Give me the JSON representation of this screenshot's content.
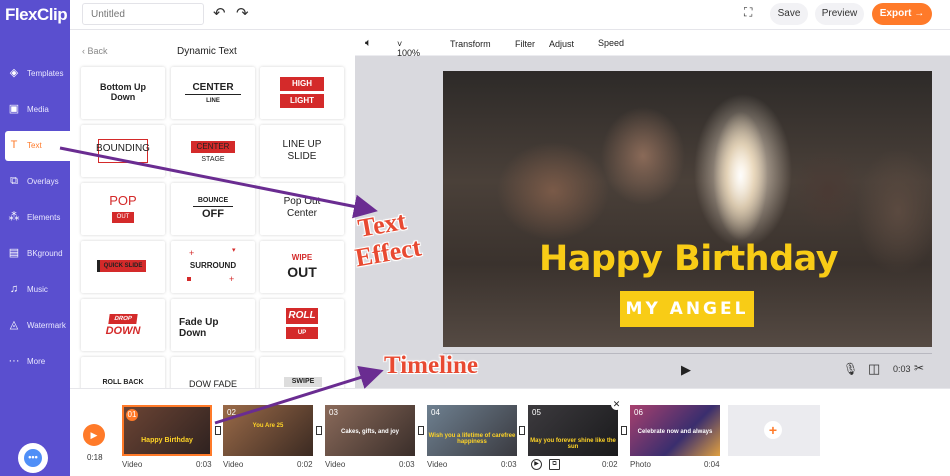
{
  "app": {
    "logo": "FlexClip",
    "project_title_placeholder": "Untitled"
  },
  "header": {
    "save": "Save",
    "preview": "Preview",
    "export": "Export →"
  },
  "sidebar": {
    "items": [
      {
        "label": "Templates",
        "icon": "layers-icon",
        "glyph": "◈"
      },
      {
        "label": "Media",
        "icon": "media-icon",
        "glyph": "▣"
      },
      {
        "label": "Text",
        "icon": "text-icon",
        "glyph": "T"
      },
      {
        "label": "Overlays",
        "icon": "overlays-icon",
        "glyph": "⧉"
      },
      {
        "label": "Elements",
        "icon": "elements-icon",
        "glyph": "⁂"
      },
      {
        "label": "BKground",
        "icon": "background-icon",
        "glyph": "▤"
      },
      {
        "label": "Music",
        "icon": "music-icon",
        "glyph": "♫"
      },
      {
        "label": "Watermark",
        "icon": "watermark-icon",
        "glyph": "◬"
      },
      {
        "label": "More",
        "icon": "more-icon",
        "glyph": "···"
      }
    ],
    "active": "Text"
  },
  "panel": {
    "back": "Back",
    "title": "Dynamic Text",
    "tiles": [
      {
        "l1": "Bottom Up",
        "l2": "Down"
      },
      {
        "l1": "CENTER",
        "l2": "LINE"
      },
      {
        "l1": "HIGH",
        "l2": "LIGHT"
      },
      {
        "l1": "BOUNDING",
        "l2": ""
      },
      {
        "l1": "CENTER",
        "l2": "STAGE"
      },
      {
        "l1": "LINE UP",
        "l2": "SLIDE"
      },
      {
        "l1": "POP",
        "l2": "OUT"
      },
      {
        "l1": "BOUNCE",
        "l2": "OFF"
      },
      {
        "l1": "Pop Out",
        "l2": "Center"
      },
      {
        "l1": "QUICK SLIDE",
        "l2": ""
      },
      {
        "l1": "SURROUND",
        "l2": ""
      },
      {
        "l1": "WIPE",
        "l2": "OUT"
      },
      {
        "l1": "DROP",
        "l2": "DOWN"
      },
      {
        "l1": "Fade Up",
        "l2": "Down"
      },
      {
        "l1": "ROLL",
        "l2": "UP"
      },
      {
        "l1": "ROLL BACK",
        "l2": ""
      },
      {
        "l1": "DOW FADE",
        "l2": ""
      },
      {
        "l1": "SWIPE",
        "l2": ""
      }
    ]
  },
  "toolbar": {
    "zoom": "100%",
    "transform": "Transform",
    "filter": "Filter",
    "adjust": "Adjust",
    "speed": "Speed"
  },
  "canvas": {
    "headline": "Happy Birthday",
    "subline": "MY ANGEL",
    "current_time": "0:03"
  },
  "timeline": {
    "elapsed": "0:18",
    "clips": [
      {
        "num": "01",
        "caption": "Happy Birthday",
        "type": "Video",
        "duration": "0:03",
        "color": "#5b3a2e"
      },
      {
        "num": "02",
        "caption": "You Are 25",
        "type": "Video",
        "duration": "0:02",
        "color": "#8a5a3c"
      },
      {
        "num": "03",
        "caption": "Cakes, gifts, and joy",
        "type": "Video",
        "duration": "0:03",
        "color": "#6e5043"
      },
      {
        "num": "04",
        "caption": "Wish you a lifetime of carefree happiness",
        "type": "Video",
        "duration": "0:03",
        "color": "#50606e"
      },
      {
        "num": "05",
        "caption": "May you forever shine like the sun",
        "type": "Video",
        "duration": "0:02",
        "color": "#2e2c30"
      },
      {
        "num": "06",
        "caption": "Celebrate now and always",
        "type": "Photo",
        "duration": "0:04",
        "color": "#8a3c6e"
      }
    ]
  },
  "annotations": {
    "text_effect_l1": "Text",
    "text_effect_l2": "Effect",
    "timeline": "Timeline"
  }
}
